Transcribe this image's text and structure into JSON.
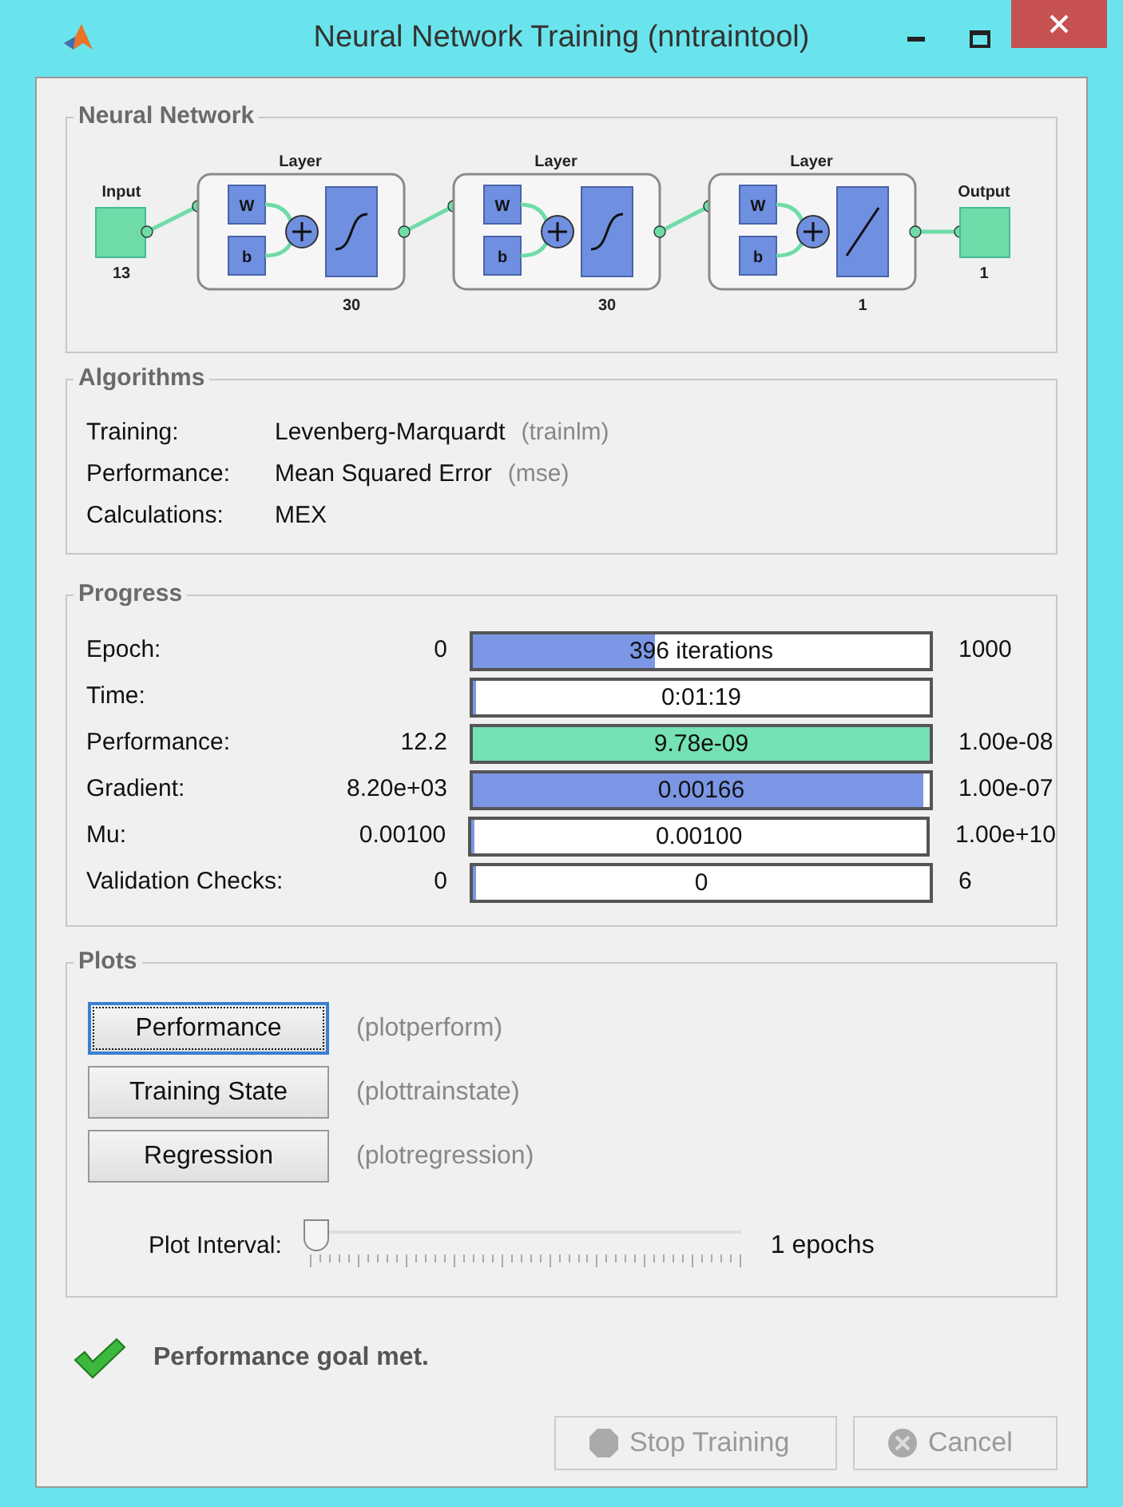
{
  "window": {
    "title": "Neural Network Training (nntraintool)"
  },
  "network": {
    "title": "Neural Network",
    "input": {
      "label": "Input",
      "size": "13"
    },
    "layers": [
      {
        "label": "Layer",
        "weight": "W",
        "bias": "b",
        "size": "30",
        "kind": "sigmoid"
      },
      {
        "label": "Layer",
        "weight": "W",
        "bias": "b",
        "size": "30",
        "kind": "sigmoid"
      },
      {
        "label": "Layer",
        "weight": "W",
        "bias": "b",
        "size": "1",
        "kind": "linear"
      }
    ],
    "output": {
      "label": "Output",
      "size": "1"
    }
  },
  "algorithms": {
    "title": "Algorithms",
    "rows": [
      {
        "label": "Training:",
        "value": "Levenberg-Marquardt",
        "note": "(trainlm)"
      },
      {
        "label": "Performance:",
        "value": "Mean Squared Error",
        "note": "(mse)"
      },
      {
        "label": "Calculations:",
        "value": "MEX"
      }
    ]
  },
  "progress": {
    "title": "Progress",
    "rows": [
      {
        "label": "Epoch:",
        "start": "0",
        "text": "396 iterations",
        "level": 0.4,
        "color": "#7b96e4",
        "end": "1000"
      },
      {
        "label": "Time:",
        "text": "0:01:19",
        "level": 0
      },
      {
        "label": "Performance:",
        "start": "12.2",
        "text": "9.78e-09",
        "level": 1,
        "color": "#74e2b3",
        "end": "1.00e-08"
      },
      {
        "label": "Gradient:",
        "start": "8.20e+03",
        "text": "0.00166",
        "level": 0.985,
        "color": "#7b96e4",
        "end": "1.00e-07"
      },
      {
        "label": "Mu:",
        "start": "0.00100",
        "text": "0.00100",
        "level": 0,
        "end": "1.00e+10"
      },
      {
        "label": "Validation Checks:",
        "start": "0",
        "text": "0",
        "level": 0,
        "end": "6"
      }
    ]
  },
  "plots": {
    "title": "Plots",
    "buttons": [
      {
        "label": "Performance",
        "note": "(plotperform)",
        "selected": true
      },
      {
        "label": "Training State",
        "note": "(plottrainstate)",
        "selected": false
      },
      {
        "label": "Regression",
        "note": "(plotregression)",
        "selected": false
      }
    ],
    "interval": {
      "label": "Plot Interval:",
      "level": 0,
      "reading": "1 epochs"
    }
  },
  "status": "Performance goal met.",
  "actions": [
    {
      "label": "Stop Training",
      "kind": "stop",
      "disabled": true
    },
    {
      "label": "Cancel",
      "kind": "cancel",
      "disabled": true
    }
  ]
}
